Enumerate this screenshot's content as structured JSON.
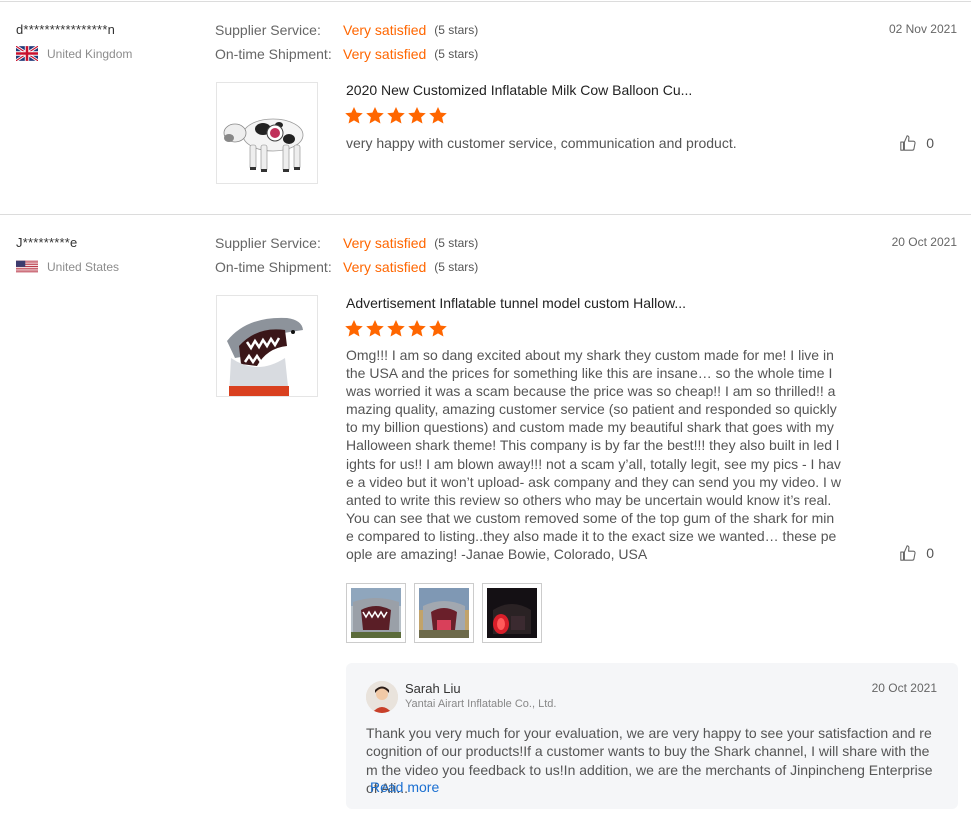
{
  "colors": {
    "accent": "#ff6600",
    "link": "#1a6fd1",
    "divider": "#dcdcdc"
  },
  "reviews": [
    {
      "user": "d****************n",
      "country": "United Kingdom",
      "flag_icon": "uk-flag-icon",
      "supplier_service_label": "Supplier Service:",
      "supplier_service_value": "Very satisfied",
      "supplier_service_stars": "(5 stars)",
      "shipment_label": "On-time Shipment:",
      "shipment_value": "Very satisfied",
      "shipment_stars": "(5 stars)",
      "date": "02 Nov 2021",
      "product_title": "2020 New Customized Inflatable Milk Cow Balloon Cu...",
      "rating": 5,
      "comment": "very happy with customer service, communication and product.",
      "likes": "0"
    },
    {
      "user": "J*********e",
      "country": "United States",
      "flag_icon": "us-flag-icon",
      "supplier_service_label": "Supplier Service:",
      "supplier_service_value": "Very satisfied",
      "supplier_service_stars": "(5 stars)",
      "shipment_label": "On-time Shipment:",
      "shipment_value": "Very satisfied",
      "shipment_stars": "(5 stars)",
      "date": "20 Oct 2021",
      "product_title": "Advertisement Inflatable tunnel model custom Hallow...",
      "rating": 5,
      "comment": "Omg!!! I am so dang excited about my shark they custom made for me! I live in the USA and the prices for something like this are insane… so the whole time I was worried it was a scam because the price was so cheap!! I am so thrilled!! amazing quality, amazing customer service (so patient and responded so quickly to my billion questions) and custom made my beautiful shark that goes with my Halloween shark theme! This company is by far the best!!! they also built in led lights for us!! I am blown away!!! not a scam y’all, totally legit, see my pics - I have a video but it won’t upload- ask company and they can send you my video. I wanted to write this review so others who may be uncertain would know it’s real. You can see that we custom removed some of the top gum of the shark for mine compared to listing..they also made it to the exact size we wanted… these people are amazing! -Janae Bowie, Colorado, USA",
      "likes": "0",
      "reply": {
        "name": "Sarah Liu",
        "company": "Yantai Airart Inflatable Co., Ltd.",
        "date": "20 Oct 2021",
        "text": "Thank you very much for your evaluation, we are very happy to see your satisfaction and recognition of our products!If a customer wants to buy the Shark channel, I will share with them the video you feedback to us!In addition, we are the merchants of Jinpincheng Enterprise of Ali...",
        "read_more": "Read more"
      }
    }
  ]
}
